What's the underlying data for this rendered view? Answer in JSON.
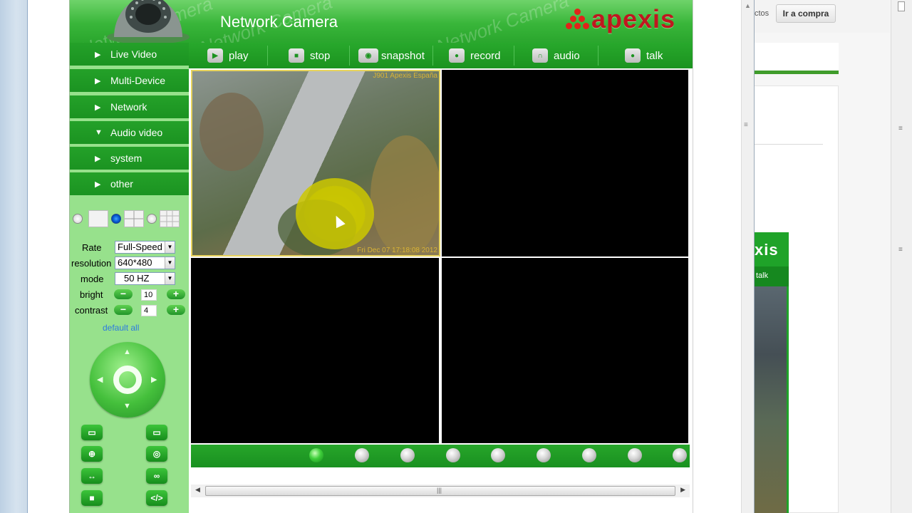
{
  "app": {
    "title": "Network Camera",
    "brand": "apexis",
    "watermark": "Network Camera"
  },
  "toolbar": {
    "buttons": [
      {
        "label": "play",
        "icon": "play-icon"
      },
      {
        "label": "stop",
        "icon": "stop-icon"
      },
      {
        "label": "snapshot",
        "icon": "camera-icon"
      },
      {
        "label": "record",
        "icon": "video-camera-icon"
      },
      {
        "label": "audio",
        "icon": "headphones-icon"
      },
      {
        "label": "talk",
        "icon": "microphone-icon"
      }
    ]
  },
  "menu": {
    "items": [
      {
        "label": "Live Video",
        "marker": "▶"
      },
      {
        "label": "Multi-Device",
        "marker": "▶"
      },
      {
        "label": "Network",
        "marker": "▶"
      },
      {
        "label": "Audio video",
        "marker": "▼"
      },
      {
        "label": "system",
        "marker": "▶"
      },
      {
        "label": "other",
        "marker": "▶"
      }
    ]
  },
  "layout": {
    "options": [
      "single-view",
      "quad-view",
      "nine-view"
    ],
    "selected": "quad-view"
  },
  "controls": {
    "rate_label": "Rate",
    "rate_value": "Full-Speed",
    "resolution_label": "resolution",
    "resolution_value": "640*480",
    "mode_label": "mode",
    "mode_value": "50 HZ",
    "bright_label": "bright",
    "bright_value": "10",
    "contrast_label": "contrast",
    "contrast_value": "4",
    "default_all": "default all"
  },
  "video": {
    "osd_title": "J901 Apexis España",
    "osd_time": "Fri Dec 07 17:18:08 2012",
    "channels": 9,
    "active_channel": 1
  },
  "right_window": {
    "cut_link": "ctos",
    "buy_button": "Ir a compra",
    "mini_logo": "xis",
    "mini_talk": "talk"
  },
  "colors": {
    "accent_green": "#1b931f",
    "sidebar_bg": "#97e18c",
    "brand_red": "#c0171f",
    "osd_yellow": "#d9b336"
  }
}
